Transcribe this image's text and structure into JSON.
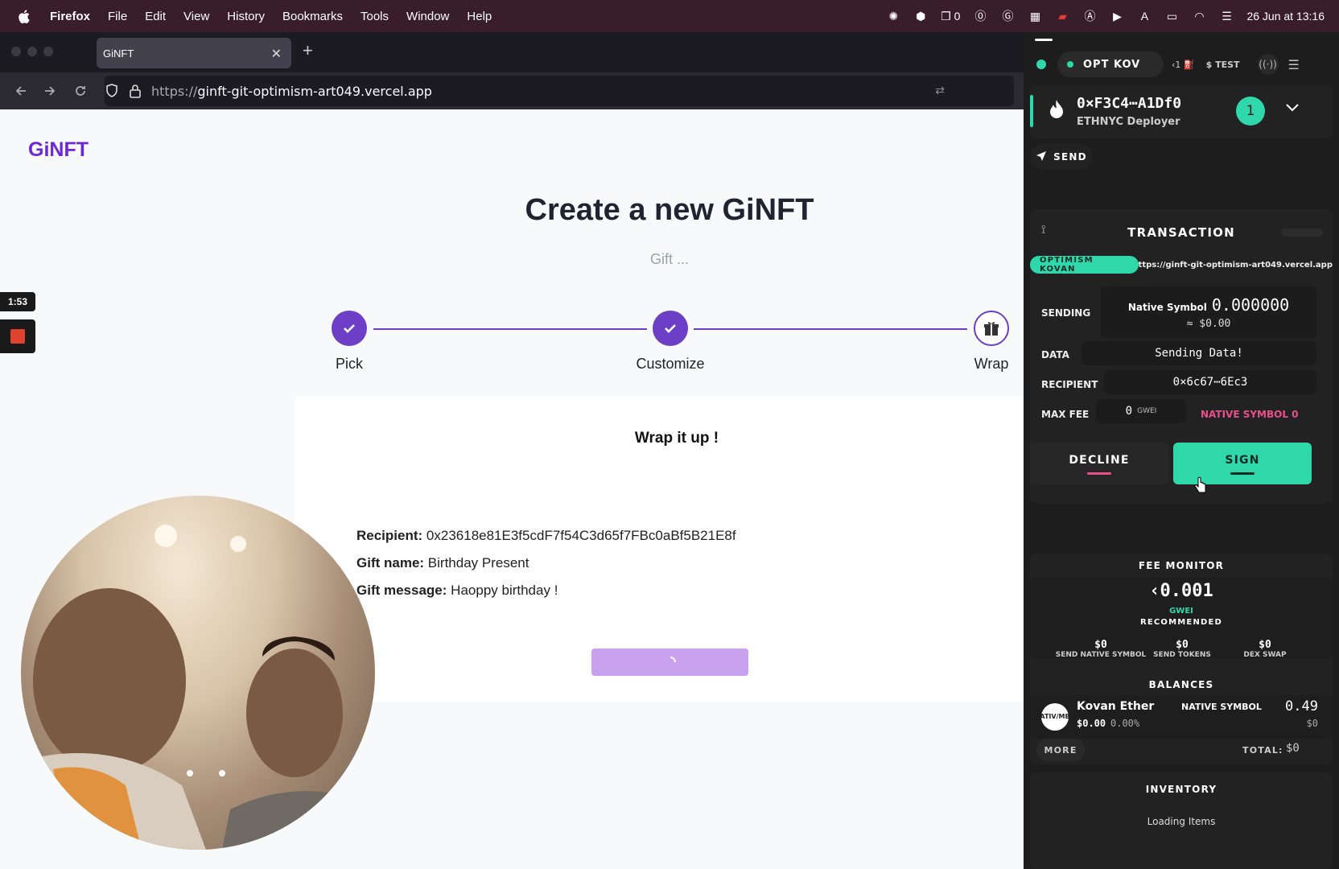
{
  "menubar": {
    "app_name": "Firefox",
    "items": [
      "File",
      "Edit",
      "View",
      "History",
      "Bookmarks",
      "Tools",
      "Window",
      "Help"
    ],
    "tray_count": "0",
    "datetime": "26 Jun at 13:16"
  },
  "browser": {
    "tab_title": "GiNFT",
    "url_prefix": "https://",
    "url_main": "ginft-git-optimism-art049.vercel.app"
  },
  "page": {
    "logo": "GiNFT",
    "title": "Create a new GiNFT",
    "subtitle": "Gift ...",
    "steps": [
      {
        "label": "Pick",
        "state": "done"
      },
      {
        "label": "Customize",
        "state": "done"
      },
      {
        "label": "Wrap",
        "state": "current"
      }
    ],
    "card": {
      "title": "Wrap it up !",
      "recipient_label": "Recipient:",
      "recipient_value": "0x23618e81E3f5cdF7f54C3d65f7FBc0aBf5B21E8f",
      "gift_name_label": "Gift name:",
      "gift_name_value": "Birthday Present",
      "gift_message_label": "Gift message:",
      "gift_message_value": "Haoppy birthday !"
    }
  },
  "recorder": {
    "timer": "1:53"
  },
  "wallet": {
    "network": "OPT KOV",
    "gas_indicator": "‹1",
    "currency": "$ TEST",
    "account_address": "0×F3C4⋯A1Df0",
    "account_name": "ETHNYC Deployer",
    "account_badge": "1",
    "send_label": "SEND",
    "tx_header": "TRANSACTION",
    "chain_badge": "OPTIMISM KOVAN",
    "origin": "ttps://ginft-git-optimism-art049.vercel.app",
    "sending_label": "SENDING",
    "sending_symbol": "Native Symbol",
    "sending_amount": "0.000000",
    "sending_usd": "≈ $0.00",
    "data_label": "DATA",
    "data_value": "Sending Data!",
    "recipient_label": "RECIPIENT",
    "recipient_value": "0×6c67⋯6Ec3",
    "maxfee_label": "MAX FEE",
    "maxfee_value": "0",
    "maxfee_unit": "GWEI",
    "maxfee_native": "NATIVE SYMBOL 0",
    "decline_label": "DECLINE",
    "sign_label": "SIGN",
    "fee_monitor_title": "FEE MONITOR",
    "fee_value": "‹0.001",
    "fee_unit": "GWEI",
    "fee_recommended": "RECOMMENDED",
    "fee_stats": [
      {
        "value": "$0",
        "label": "SEND NATIVE SYMBOL"
      },
      {
        "value": "$0",
        "label": "SEND TOKENS"
      },
      {
        "value": "$0",
        "label": "DEX SWAP"
      }
    ],
    "balances_title": "BALANCES",
    "token_icon_text": "ATIV/MB",
    "token_name": "Kovan Ether",
    "token_usd": "$0.00",
    "token_pct": "0.00%",
    "token_symbol": "NATIVE SYMBOL",
    "token_amount": "0.49",
    "token_amount_usd": "$0",
    "more_label": "MORE",
    "total_label": "TOTAL:",
    "total_value": "$0",
    "inventory_title": "INVENTORY",
    "inventory_loading": "Loading Items"
  },
  "colors": {
    "accent_purple": "#6d3fc7",
    "wallet_green": "#2fd8ab",
    "wallet_pink": "#e8508a",
    "menubar_bg": "#3a1d2b"
  }
}
